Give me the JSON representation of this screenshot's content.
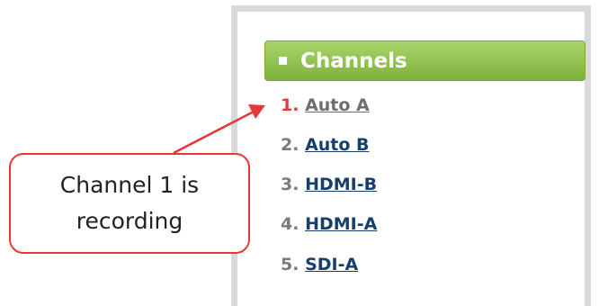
{
  "panel": {
    "title": "Channels",
    "channels": [
      {
        "number": "1.",
        "label": "Auto A",
        "recording": true
      },
      {
        "number": "2.",
        "label": "Auto B",
        "recording": false
      },
      {
        "number": "3.",
        "label": "HDMI-B",
        "recording": false
      },
      {
        "number": "4.",
        "label": "HDMI-A",
        "recording": false
      },
      {
        "number": "5.",
        "label": "SDI-A",
        "recording": false
      }
    ]
  },
  "callout": {
    "text": "Channel 1 is\nrecording"
  },
  "colors": {
    "header_green": "#8cc04a",
    "recording_red": "#e33b3b",
    "link_blue": "#173f6e",
    "callout_border": "#e53838"
  }
}
